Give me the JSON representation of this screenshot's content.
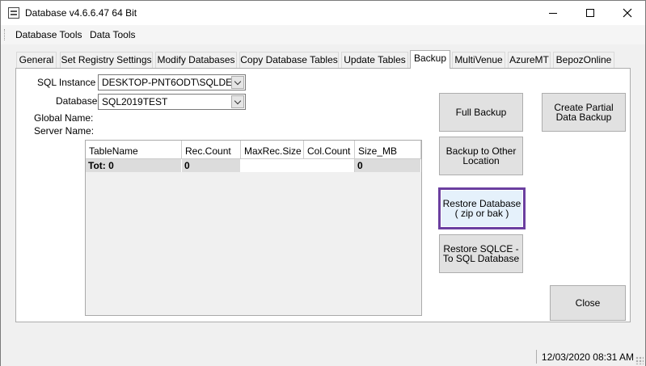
{
  "window": {
    "title": "Database v4.6.6.47 64 Bit",
    "icon": "database-app-icon"
  },
  "menu": {
    "items": [
      "Database Tools",
      "Data Tools"
    ]
  },
  "tabs": [
    {
      "label": "General"
    },
    {
      "label": "Set Registry Settings"
    },
    {
      "label": "Modify Databases"
    },
    {
      "label": "Copy Database Tables"
    },
    {
      "label": "Update Tables"
    },
    {
      "label": "Backup",
      "active": true
    },
    {
      "label": "MultiVenue"
    },
    {
      "label": "AzureMT"
    },
    {
      "label": "BepozOnline"
    }
  ],
  "form": {
    "sql_instance_label": "SQL Instance :",
    "sql_instance_value": "DESKTOP-PNT6ODT\\SQLDE",
    "database_label": "Database:",
    "database_value": "SQL2019TEST",
    "global_name_label": "Global Name:",
    "server_name_label": "Server Name:"
  },
  "grid": {
    "columns": [
      "TableName",
      "Rec.Count",
      "MaxRec.Size",
      "Col.Count",
      "Size_MB"
    ],
    "totals": [
      "Tot: 0",
      "0",
      "",
      "",
      "0"
    ]
  },
  "buttons": {
    "full_backup": "Full Backup",
    "create_partial": "Create Partial\nData Backup",
    "backup_other": "Backup to Other\nLocation",
    "restore_database": "Restore Database\n( zip or bak )",
    "restore_sqlce": "Restore SQLCE -\nTo SQL Database",
    "close": "Close"
  },
  "status": {
    "datetime": "12/03/2020 08:31 AM"
  },
  "colors": {
    "focus_border": "#6b3fa0",
    "button_face": "#e1e1e1"
  }
}
